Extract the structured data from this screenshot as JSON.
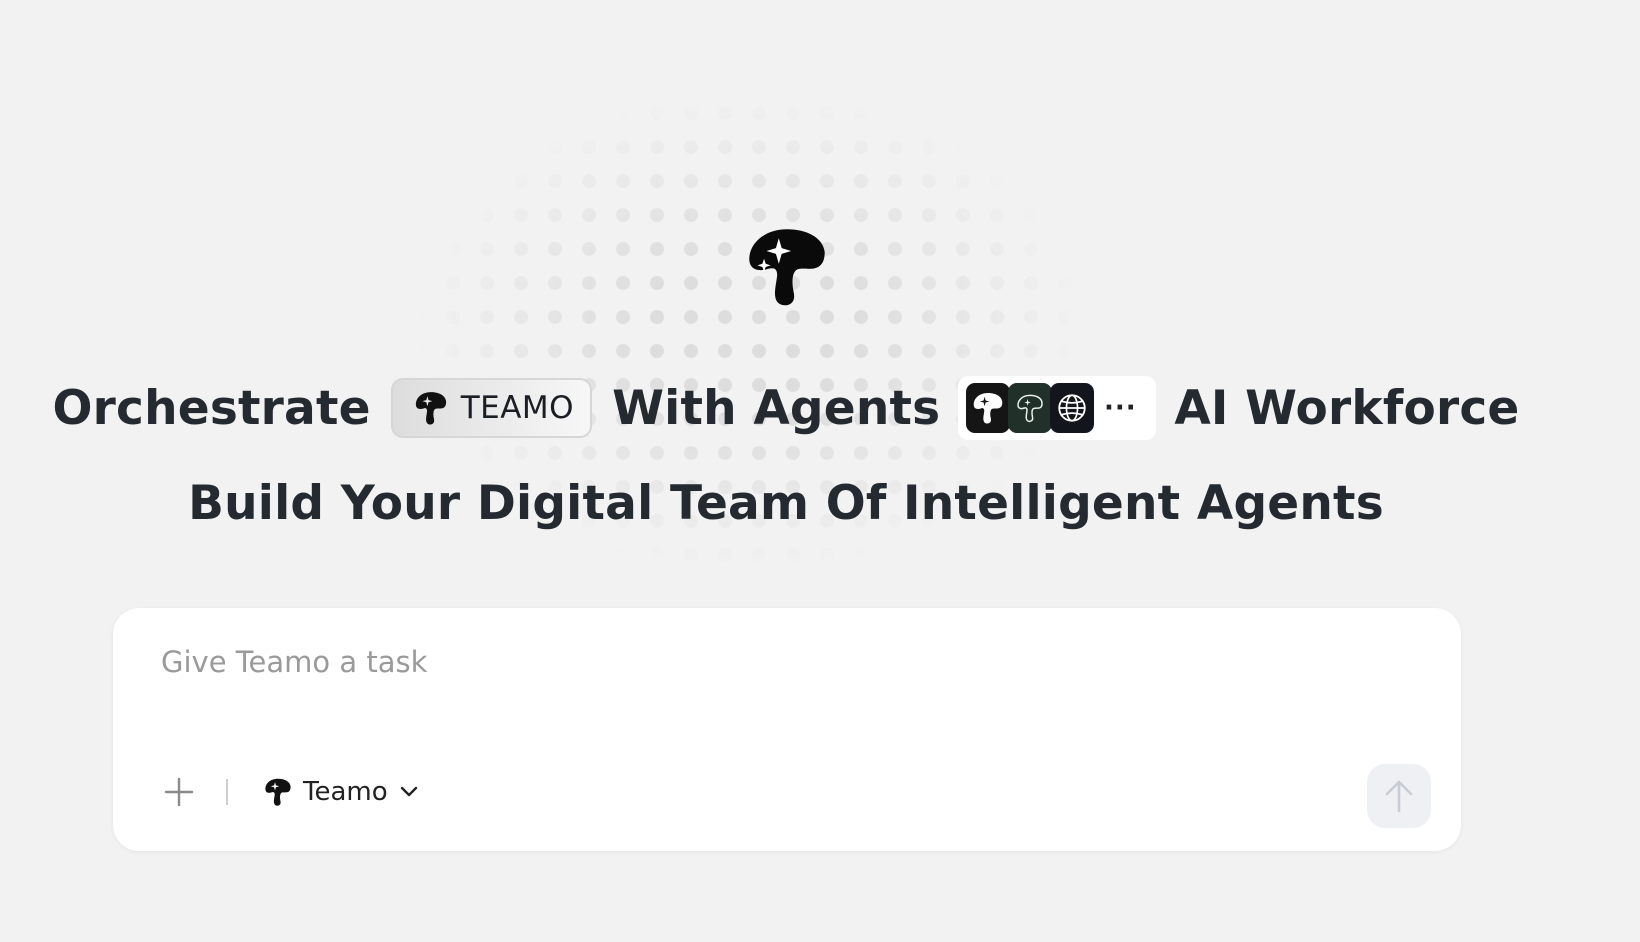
{
  "hero": {
    "headline_start": "Orchestrate",
    "brand_pill_text": "TEAMO",
    "headline_middle": "With Agents",
    "more_agents": "···",
    "headline_end": "AI Workforce",
    "subheadline": "Build Your Digital Team Of Intelligent Agents",
    "logo_icon": "mushroom-sparkle-icon",
    "agent_icons": [
      "mushroom-agent-icon",
      "mushroom-outline-agent-icon",
      "globe-agent-icon"
    ]
  },
  "composer": {
    "placeholder": "Give Teamo a task",
    "value": "",
    "add_icon": "plus-icon",
    "selected_agent": "Teamo",
    "selector_icon": "mushroom-icon",
    "dropdown_icon": "chevron-down-icon",
    "send_icon": "arrow-up-icon"
  },
  "colors": {
    "page_background": "#f2f2f2",
    "heading_text": "#252a31",
    "panel_background": "#ffffff",
    "send_button_background": "#eef0f3",
    "send_arrow": "#c8cdd5",
    "placeholder_text": "#9a9a9a"
  }
}
